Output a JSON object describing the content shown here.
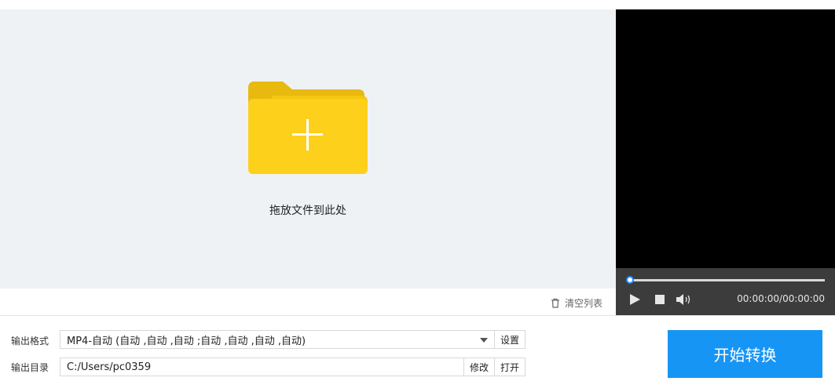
{
  "dropzone": {
    "text": "拖放文件到此处",
    "folder_icon": "folder-plus-icon",
    "folder_color": "#fdd01c"
  },
  "list_actions": {
    "clear_label": "清空列表",
    "clear_icon": "trash-icon"
  },
  "player": {
    "time": "00:00:00/00:00:00",
    "progress": 0,
    "icons": [
      "play-icon",
      "stop-icon",
      "volume-icon"
    ]
  },
  "output": {
    "format_label": "输出格式",
    "format_value": "MP4-自动 (自动 ,自动 ,自动 ;自动 ,自动 ,自动 ,自动)",
    "settings_label": "设置",
    "dir_label": "输出目录",
    "dir_value": "C:/Users/pc0359",
    "modify_label": "修改",
    "open_label": "打开"
  },
  "start_button": {
    "label": "开始转换",
    "color": "#1795f5"
  }
}
